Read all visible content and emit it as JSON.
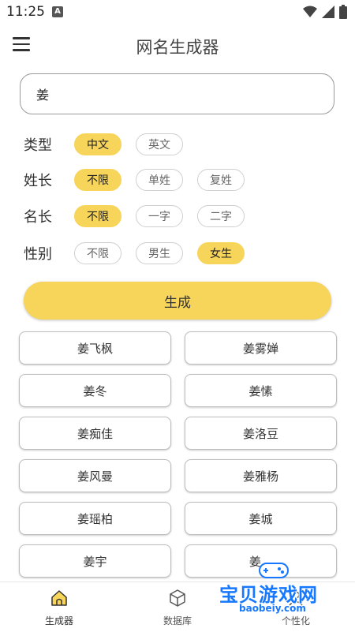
{
  "status_bar": {
    "time": "11:25",
    "notification_letter": "A"
  },
  "app_bar": {
    "title": "网名生成器"
  },
  "search": {
    "value": "姜"
  },
  "options": {
    "type": {
      "label": "类型",
      "choices": [
        "中文",
        "英文"
      ],
      "selected": "中文"
    },
    "surname_length": {
      "label": "姓长",
      "choices": [
        "不限",
        "单姓",
        "复姓"
      ],
      "selected": "不限"
    },
    "name_length": {
      "label": "名长",
      "choices": [
        "不限",
        "一字",
        "二字"
      ],
      "selected": "不限"
    },
    "gender": {
      "label": "性别",
      "choices": [
        "不限",
        "男生",
        "女生"
      ],
      "selected": "女生"
    }
  },
  "generate_button": {
    "label": "生成"
  },
  "results": [
    "姜飞枫",
    "姜雾婵",
    "姜冬",
    "姜愫",
    "姜痴佳",
    "姜洛豆",
    "姜风曼",
    "姜雅杨",
    "姜瑶柏",
    "姜城",
    "姜宇",
    "姜..."
  ],
  "bottom_nav": {
    "items": [
      {
        "label": "生成器",
        "icon": "home-icon"
      },
      {
        "label": "数据库",
        "icon": "cube-icon"
      },
      {
        "label": "个性化",
        "icon": "person-icon"
      }
    ]
  },
  "watermark": {
    "text": "宝贝游戏网",
    "url": "baobeiy.com"
  },
  "colors": {
    "accent": "#f7d45a",
    "watermark": "#1677ff"
  }
}
